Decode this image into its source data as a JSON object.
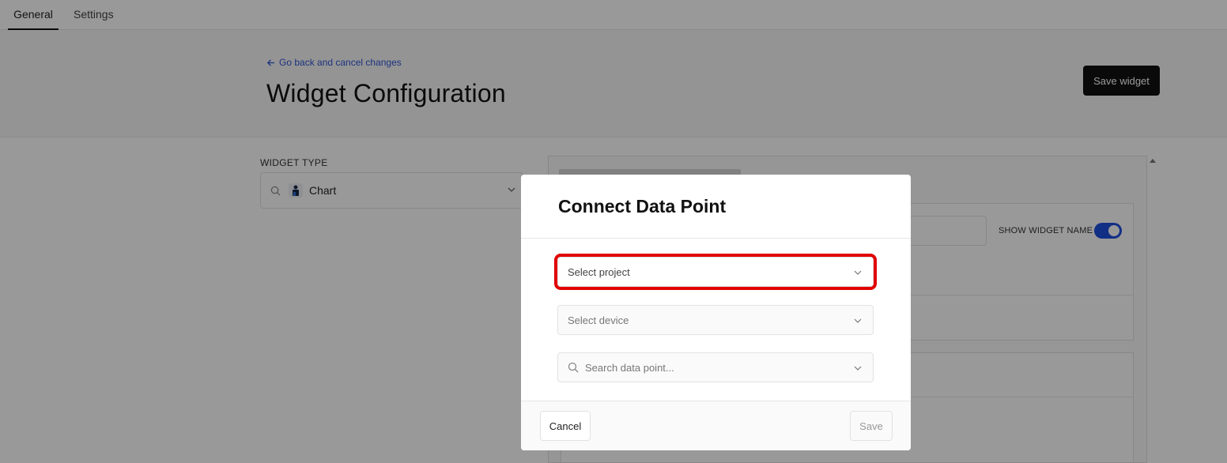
{
  "tabs": [
    {
      "label": "General",
      "active": true
    },
    {
      "label": "Settings",
      "active": false
    }
  ],
  "header": {
    "back_link": "Go back and cancel changes",
    "title": "Widget Configuration",
    "save_button": "Save widget"
  },
  "widget_type": {
    "label": "WIDGET TYPE",
    "value": "Chart",
    "icon": "chart-icon"
  },
  "panel": {
    "show_widget_name_label": "SHOW WIDGET NAME",
    "show_widget_name_on": true
  },
  "modal": {
    "title": "Connect Data Point",
    "project_placeholder": "Select project",
    "device_placeholder": "Select device",
    "search_placeholder": "Search data point...",
    "cancel_label": "Cancel",
    "save_label": "Save"
  },
  "colors": {
    "accent": "#1f4fe0",
    "highlight": "#e00000",
    "primary_button": "#111111"
  }
}
